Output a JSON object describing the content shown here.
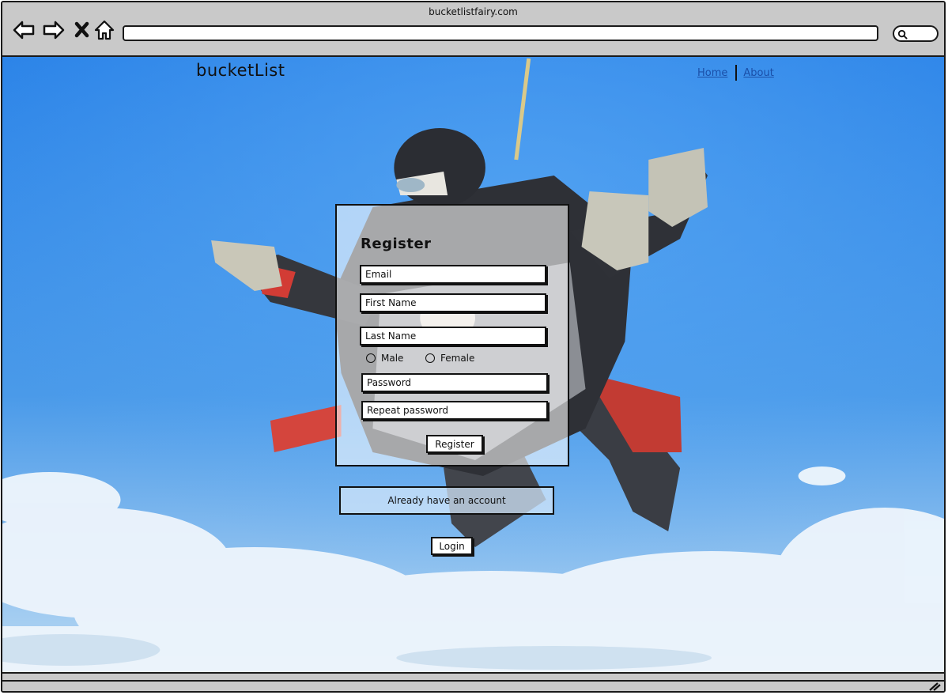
{
  "browser": {
    "url": "bucketlistfairy.com",
    "nav_icons": [
      "back-arrow-icon",
      "forward-arrow-icon",
      "close-icon",
      "home-icon"
    ],
    "search_icon": "search-icon"
  },
  "site": {
    "brand": "bucketList",
    "nav": [
      {
        "label": "Home"
      },
      {
        "label": "About"
      }
    ]
  },
  "register": {
    "title": "Register",
    "email_placeholder": "Email",
    "first_name_placeholder": "First Name",
    "last_name_placeholder": "Last Name",
    "gender_options": [
      "Male",
      "Female"
    ],
    "password_placeholder": "Password",
    "repeat_password_placeholder": "Repeat password",
    "submit_label": "Register"
  },
  "login": {
    "prompt": "Already have an account",
    "button_label": "Login"
  },
  "colors": {
    "sky_top": "#2f86e6",
    "sky_bottom": "#8fc4f2",
    "link": "#1a4fa8",
    "chrome": "#c9c9c9"
  }
}
